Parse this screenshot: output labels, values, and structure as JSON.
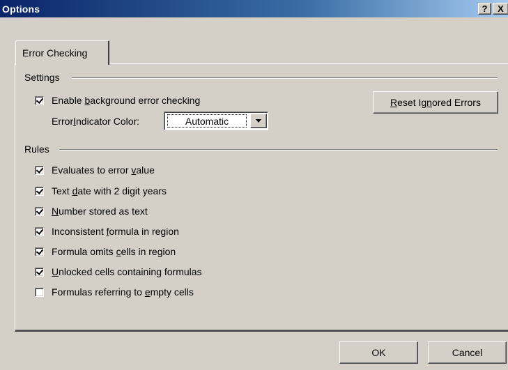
{
  "window": {
    "title": "Options",
    "help_label": "?",
    "close_label": "X"
  },
  "tabs": [
    {
      "label": "Error Checking",
      "active": true
    }
  ],
  "settings": {
    "group_label": "Settings",
    "enable_bg": {
      "pre": "Enable ",
      "key": "b",
      "post": "ackground error checking",
      "checked": true
    },
    "indicator": {
      "pre": "Error ",
      "key": "I",
      "post": "ndicator Color:",
      "value": "Automatic"
    },
    "reset_button": {
      "key": "R",
      "mid": "eset Ig",
      "key2": "n",
      "post": "ored Errors"
    }
  },
  "rules": {
    "group_label": "Rules",
    "items": [
      {
        "pre": "Evaluates to error ",
        "key": "v",
        "post": "alue",
        "checked": true
      },
      {
        "pre": "Text ",
        "key": "d",
        "post": "ate with 2 digit years",
        "checked": true
      },
      {
        "pre": "",
        "key": "N",
        "post": "umber stored as text",
        "checked": true
      },
      {
        "pre": "Inconsistent ",
        "key": "f",
        "post": "ormula in region",
        "checked": true
      },
      {
        "pre": "Formula omits ",
        "key": "c",
        "post": "ells in region",
        "checked": true
      },
      {
        "pre": "",
        "key": "U",
        "post": "nlocked cells containing formulas",
        "checked": true
      },
      {
        "pre": "Formulas referring to ",
        "key": "e",
        "post": "mpty cells",
        "checked": false
      }
    ]
  },
  "footer": {
    "ok_label": "OK",
    "cancel_label": "Cancel"
  },
  "colors": {
    "dialog_bg": "#d4d0c8",
    "title_bar_start": "#0a246a",
    "title_bar_end": "#a6caf0"
  }
}
